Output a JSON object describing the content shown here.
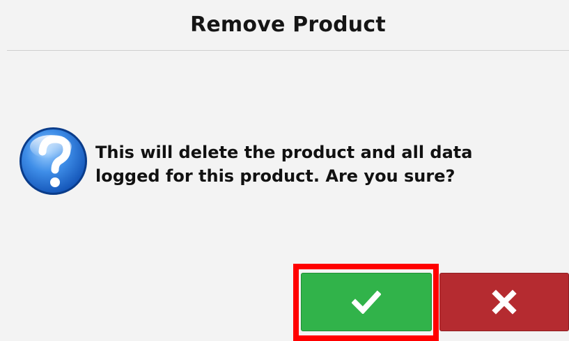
{
  "dialog": {
    "title": "Remove Product",
    "message_line_1": "This will delete the product and all data",
    "message_line_2": "logged for this product.  Are you sure?",
    "icon": "question-icon"
  },
  "buttons": {
    "confirm_icon": "checkmark-icon",
    "cancel_icon": "close-icon"
  },
  "colors": {
    "confirm": "#31b34a",
    "cancel": "#b52b30",
    "highlight": "#ff0000",
    "background": "#f3f3f3"
  }
}
